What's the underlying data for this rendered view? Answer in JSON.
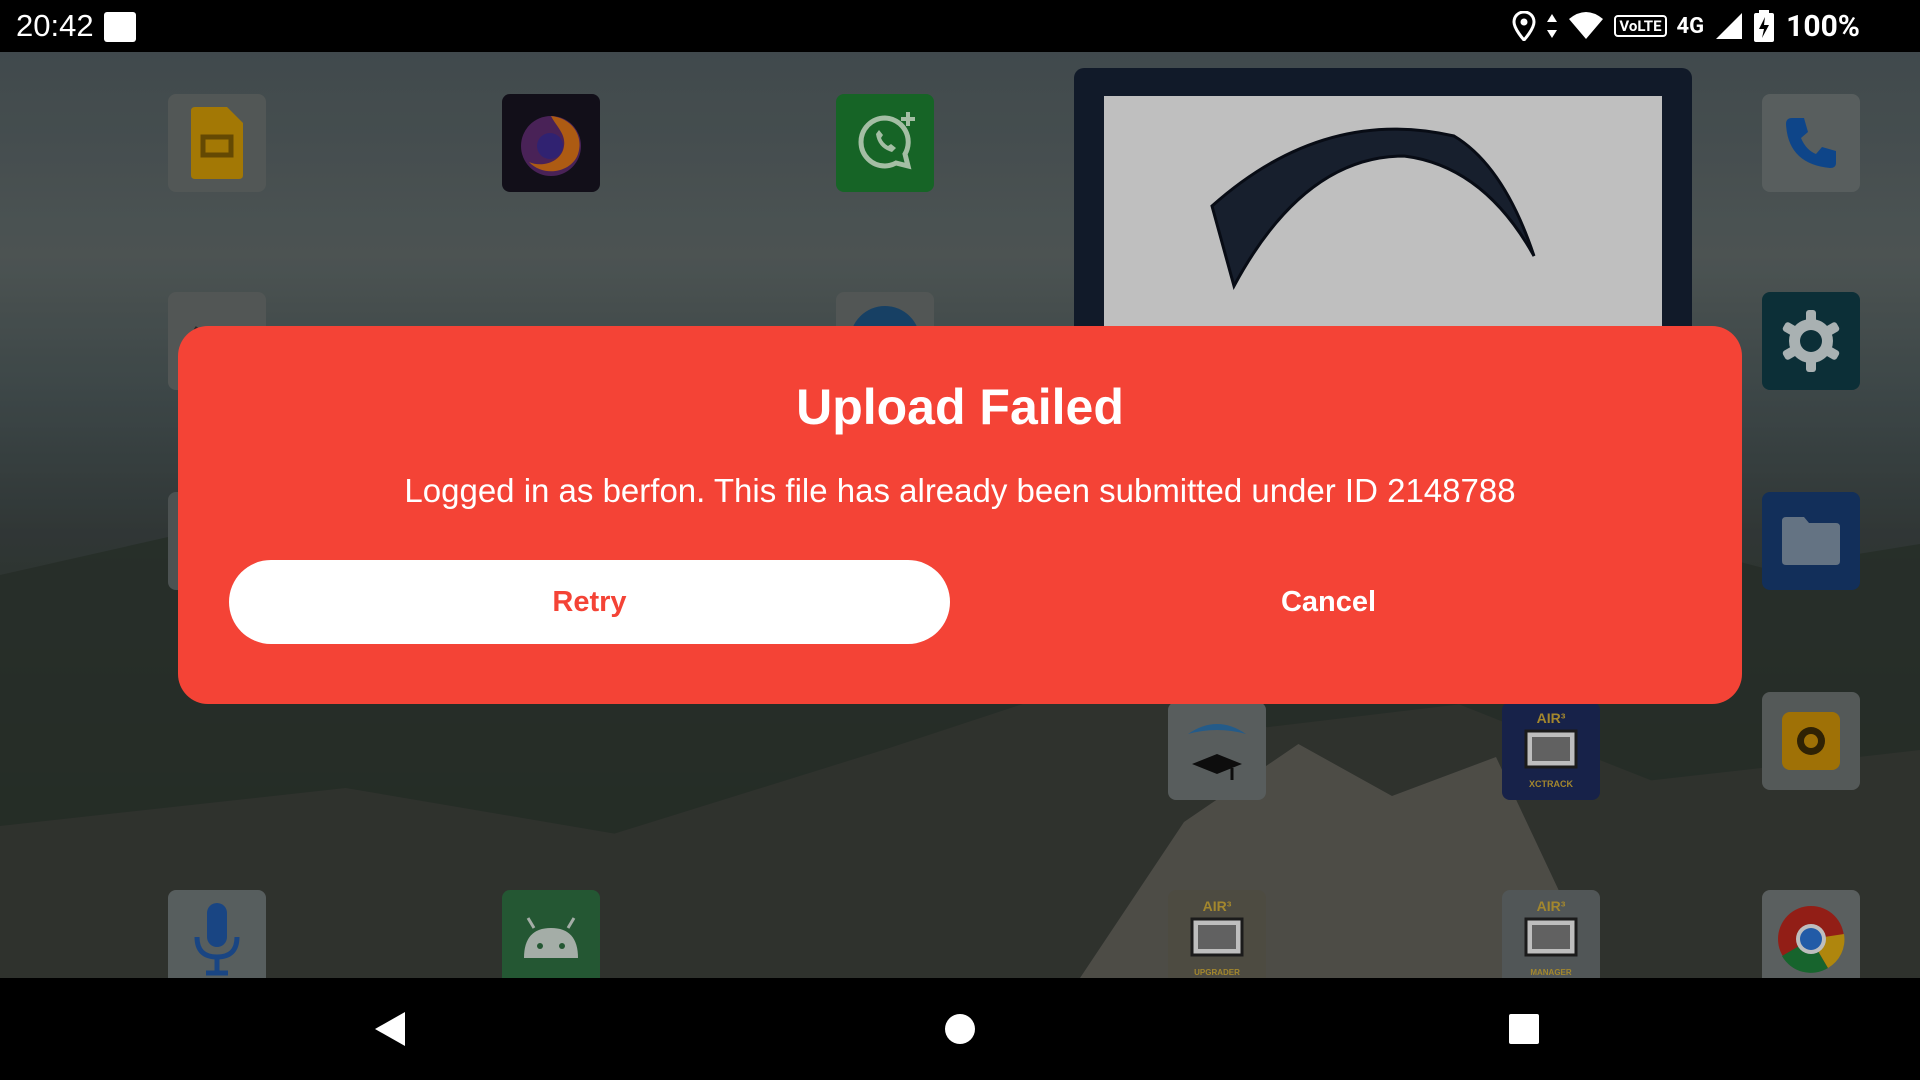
{
  "status_bar": {
    "time": "20:42",
    "volte_label": "VoLTE",
    "network_label": "4G",
    "battery": "100%"
  },
  "home": {
    "apps": [
      {
        "name": "Google Slides",
        "icon": "slides-icon"
      },
      {
        "name": "Firefox",
        "icon": "firefox-icon"
      },
      {
        "name": "WhatsApp",
        "icon": "whatsapp-icon"
      },
      {
        "name": "Phone",
        "icon": "phone-icon"
      },
      {
        "name": "Settings",
        "icon": "gear-icon"
      },
      {
        "name": "Files",
        "icon": "folder-icon"
      },
      {
        "name": "Camera",
        "icon": "camera-icon"
      },
      {
        "name": "Voice Recorder",
        "icon": "microphone-icon"
      },
      {
        "name": "Android App",
        "icon": "android-icon"
      },
      {
        "name": "Chrome",
        "icon": "chrome-icon"
      }
    ],
    "air_labels": {
      "air": "AIR³",
      "xctrack": "XCTRACK",
      "upgrader": "UPGRADER",
      "manager": "MANAGER"
    }
  },
  "dialog": {
    "title": "Upload Failed",
    "message": "Logged in as berfon. This file has already been submitted under ID 2148788",
    "retry_label": "Retry",
    "cancel_label": "Cancel",
    "accent_color": "#f44336"
  },
  "nav": {
    "back": "back-icon",
    "home": "home-icon",
    "recents": "recents-icon"
  }
}
